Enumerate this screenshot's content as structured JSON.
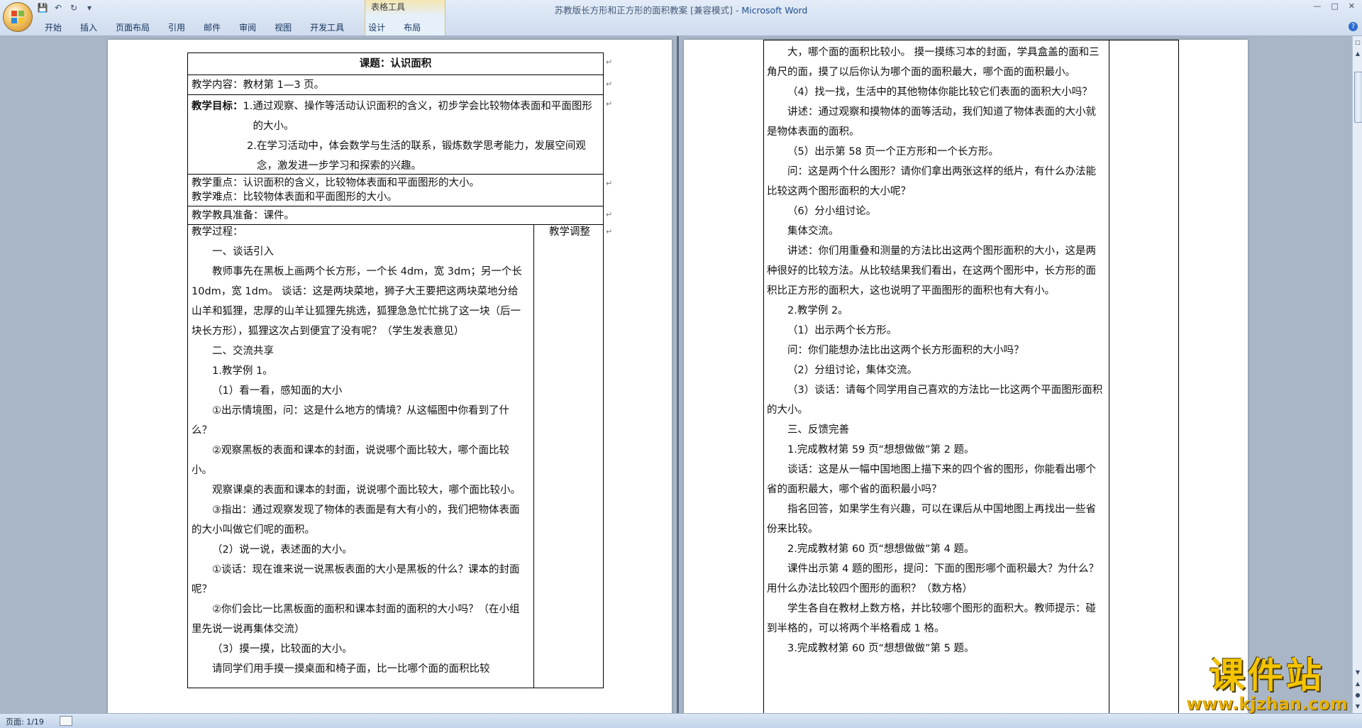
{
  "window": {
    "doc_title": "苏教版长方形和正方形的面积教案 [兼容模式] - ",
    "app_name": "Microsoft Word",
    "context_tab_group": "表格工具",
    "tabs": [
      "开始",
      "插入",
      "页面布局",
      "引用",
      "邮件",
      "审阅",
      "视图",
      "开发工具",
      "设计",
      "布局"
    ]
  },
  "status_bar": {
    "page": "页面: 1/19"
  },
  "page1": {
    "title_prefix": "课题：",
    "title": "认识面积",
    "content_label": "教学内容：",
    "content": "教材第 1—3 页。",
    "goal_label": "教学目标：",
    "goal1": "1.通过观察、操作等活动认识面积的含义，初步学会比较物体表面和平面图形的大小。",
    "goal2": "2.在学习活动中，体会数学与生活的联系，锻炼数学思考能力，发展空间观念，激发进一步学习和探索的兴趣。",
    "key_label": "教学重点：",
    "key": "认识面积的含义，比较物体表面和平面图形的大小。",
    "difficulty_label": "教学难点：",
    "difficulty": "比较物体表面和平面图形的大小。",
    "prep_label": "教学教具准备：",
    "prep": "课件。",
    "process_label": "教学过程：",
    "adjust_label": "教学调整",
    "paragraphs": [
      "一、谈话引入",
      "教师事先在黑板上画两个长方形，一个长 4dm，宽 3dm；另一个长 10dm，宽 1dm。 谈话：这是两块菜地，狮子大王要把这两块菜地分给山羊和狐狸，忠厚的山羊让狐狸先挑选，狐狸急急忙忙挑了这一块（后一块长方形），狐狸这次占到便宜了没有呢？（学生发表意见）",
      "二、交流共享",
      "1.教学例 1。",
      "（1）看一看，感知面的大小",
      "①出示情境图，问：这是什么地方的情境？从这幅图中你看到了什么？",
      "②观察黑板的表面和课本的封面，说说哪个面比较大，哪个面比较小。",
      "观察课桌的表面和课本的封面，说说哪个面比较大，哪个面比较小。",
      "③指出：通过观察发现了物体的表面是有大有小的，我们把物体表面的大小叫做它们呢的面积。",
      "（2）说一说，表述面的大小。",
      "①谈话：现在谁来说一说黑板表面的大小是黑板的什么？课本的封面呢？",
      "②你们会比一比黑板面的面积和课本封面的面积的大小吗？（在小组里先说一说再集体交流）",
      "（3）摸一摸，比较面的大小。",
      "请同学们用手摸一摸桌面和椅子面，比一比哪个面的面积比较"
    ]
  },
  "page2": {
    "paragraphs": [
      "大，哪个面的面积比较小。 摸一摸练习本的封面，学具盒盖的面和三角尺的面，摸了以后你认为哪个面的面积最大，哪个面的面积最小。",
      "（4）找一找，生活中的其他物体你能比较它们表面的面积大小吗？",
      "讲述：通过观察和摸物体的面等活动，我们知道了物体表面的大小就是物体表面的面积。",
      "（5）出示第 58 页一个正方形和一个长方形。",
      "问：这是两个什么图形？请你们拿出两张这样的纸片，有什么办法能比较这两个图形面积的大小呢？",
      "（6）分小组讨论。",
      "集体交流。",
      "讲述：你们用重叠和测量的方法比出这两个图形面积的大小，这是两种很好的比较方法。从比较结果我们看出，在这两个图形中，长方形的面积比正方形的面积大，这也说明了平面图形的面积也有大有小。",
      "2.教学例 2。",
      "（1）出示两个长方形。",
      "问：你们能想办法比出这两个长方形面积的大小吗？",
      "（2）分组讨论，集体交流。",
      "（3）谈话：请每个同学用自己喜欢的方法比一比这两个平面图形面积的大小。",
      "三、反馈完善",
      "1.完成教材第 59 页“想想做做”第 2 题。",
      "谈话：这是从一幅中国地图上描下来的四个省的图形，你能看出哪个省的面积最大，哪个省的面积最小吗？",
      "指名回答，如果学生有兴趣，可以在课后从中国地图上再找出一些省份来比较。",
      "2.完成教材第 60 页“想想做做”第 4 题。",
      "课件出示第 4 题的图形，提问：下面的图形哪个面积最大？为什么？用什么办法比较四个图形的面积？（数方格）",
      "学生各自在教材上数方格，并比较哪个图形的面积大。教师提示：碰到半格的，可以将两个半格看成 1 格。",
      "3.完成教材第 60 页“想想做做”第 5 题。"
    ]
  },
  "watermark": {
    "title": "课件站",
    "url": "www.kjzhan.com"
  },
  "colors": {
    "ribbon": "#cfdcee",
    "workspace": "#a9b6c7",
    "watermark": "#f5c400"
  }
}
